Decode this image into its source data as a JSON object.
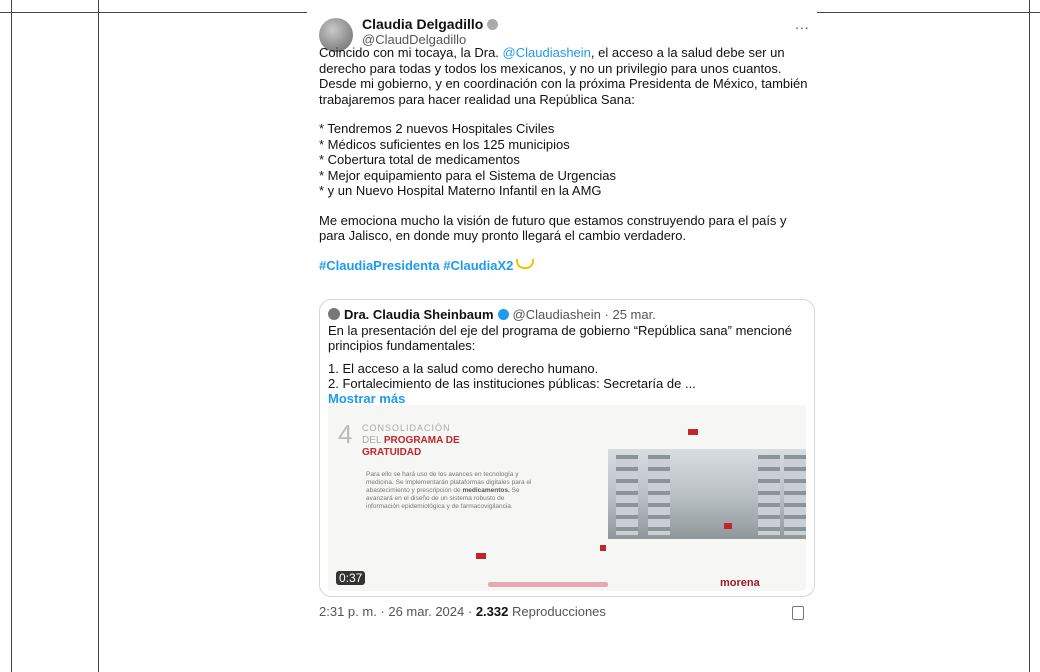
{
  "tweet": {
    "author_name": "Claudia Delgadillo",
    "author_handle": "@ClaudDelgadillo",
    "more_label": "...",
    "intro_before": "Coincido con mi tocaya, la Dra. ",
    "intro_mention": "@Claudiashein",
    "intro_after": ", el acceso a la salud debe ser un derecho para todas y todos los mexicanos, y no un privilegio para unos cuantos. Desde mi gobierno, y en coordinación con la próxima Presidenta de México, también trabajaremos para hacer realidad una República Sana:",
    "bullets": [
      "* Tendremos 2 nuevos Hospitales Civiles",
      "* Médicos suficientes en los 125 municipios",
      "* Cobertura total de medicamentos",
      "* Mejor equipamiento para el Sistema de Urgencias",
      "* y un Nuevo Hospital Materno Infantil en la AMG"
    ],
    "closing": "Me emociona mucho la visión de futuro que estamos construyendo para el país y para Jalisco, en donde muy pronto llegará el cambio verdadero.",
    "hashtags": "#ClaudiaPresidenta #ClaudiaX2",
    "footer_time": "2:31 p. m. · 26 mar. 2024 · ",
    "footer_views": "2.332",
    "footer_views_label": " Reproducciones"
  },
  "quote": {
    "author_name": "Dra. Claudia Sheinbaum",
    "author_handle": "@Claudiashein",
    "date": " · 25 mar.",
    "text1": "En la presentación del eje del programa de gobierno “República sana” mencioné principios fundamentales:",
    "item1": "1. El acceso a la salud como derecho humano.",
    "item2": "2. Fortalecimiento de las instituciones públicas: Secretaría de ...",
    "show_more": "Mostrar más"
  },
  "media": {
    "number": "4",
    "title1": "CONSOLIDACIÓN",
    "title2_prefix": "DEL ",
    "title2_bold": "PROGRAMA DE",
    "title3": "GRATUIDAD",
    "desc_before": "Para ello se hará uso de los avances en tecnología y medicina. Se implementarán plataformas digitales para el abastecimiento y prescripción de ",
    "desc_bold": "medicamentos.",
    "desc_after": " Se avanzará en el diseño de un sistema robusto de información epidemiológica y de farmacovigilancia.",
    "duration": "0:37",
    "brand": "morena"
  },
  "colors": {
    "link": "#1d9bf0",
    "accent_red": "#c0262d",
    "hashtag_emoji": "#f2c200"
  },
  "icons": {
    "verified": "verified-badge-icon",
    "more": "more-options-icon",
    "bookmark": "bookmark-icon"
  }
}
